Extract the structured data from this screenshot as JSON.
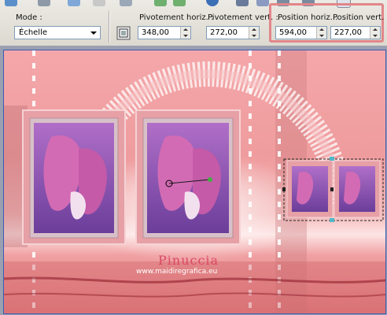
{
  "toolbar": {
    "mode_label": "Mode :",
    "mode_value": "Échelle",
    "pivot_h_label": "Pivotement horiz. :",
    "pivot_h_value": "348,00",
    "pivot_v_label": "Pivotement vert. :",
    "pivot_v_value": "272,00",
    "pos_h_label": "Position horiz. :",
    "pos_h_value": "594,00",
    "pos_v_label": "Position vert. :",
    "pos_v_value": "227,00"
  },
  "canvas": {
    "watermark_name": "Pinuccia",
    "watermark_url": "www.maidiregrafica.eu"
  },
  "colors": {
    "highlight": "#e2868a",
    "art_pink": "#f19ea0",
    "flower_violet": "#9c4fb0"
  },
  "icons": [
    "share-icon",
    "save-icon",
    "undo-icon",
    "redo-icon",
    "copy-icon",
    "rotate-icon",
    "help-icon",
    "grid-icon",
    "layout-icon"
  ]
}
